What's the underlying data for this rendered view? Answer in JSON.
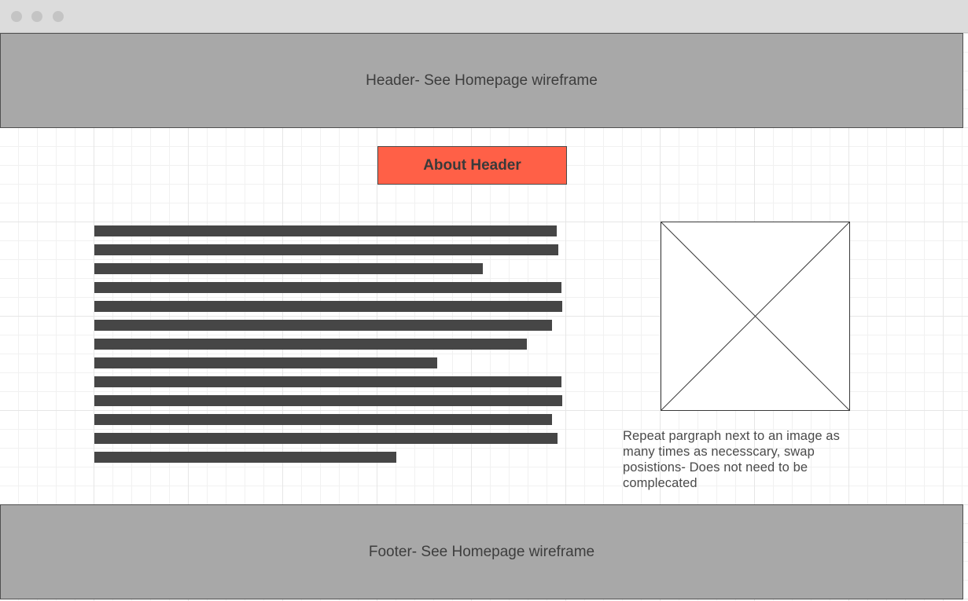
{
  "window": {
    "controls": [
      "close",
      "minimize",
      "maximize"
    ]
  },
  "header": {
    "label": "Header- See Homepage wireframe"
  },
  "about": {
    "title": "About Header"
  },
  "paragraph": {
    "line_fill_fractions": [
      0.98,
      0.983,
      0.823,
      0.99,
      0.992,
      0.97,
      0.917,
      0.727,
      0.99,
      0.992,
      0.97,
      0.982,
      0.64
    ]
  },
  "image": {
    "icon": "image-placeholder-icon"
  },
  "caption": {
    "text": "Repeat pargraph next to an image as many times as necesscary, swap posistions- Does not need to be complecated"
  },
  "footer": {
    "label": "Footer- See Homepage wireframe"
  },
  "colors": {
    "titlebar": "#dcdcdc",
    "block": "#a8a8a8",
    "accent": "#ff6047",
    "text_line": "#464646"
  }
}
